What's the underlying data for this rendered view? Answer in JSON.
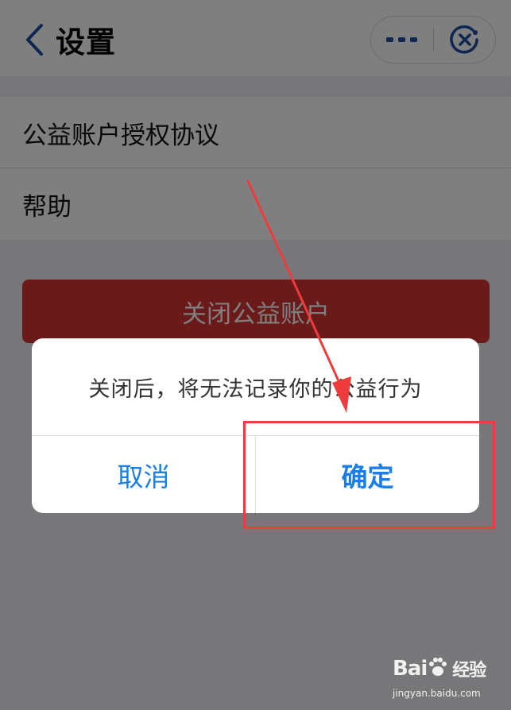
{
  "navbar": {
    "title": "设置",
    "back_icon": "chevron-left-icon",
    "more_icon": "more-dots-icon",
    "close_icon": "close-circle-icon",
    "accent_color": "#1a4fa0"
  },
  "settings_list": {
    "items": [
      {
        "label": "公益账户授权协议"
      },
      {
        "label": "帮助"
      }
    ]
  },
  "close_account_button": {
    "label": "关闭公益账户",
    "color": "#d63434"
  },
  "dialog": {
    "message": "关闭后，将无法记录你的公益行为",
    "cancel_label": "取消",
    "confirm_label": "确定",
    "button_color": "#1a7de8"
  },
  "annotation": {
    "color": "#ee3c3c"
  },
  "watermark": {
    "logo_left": "Bai",
    "logo_right": "经验",
    "url": "jingyan.baidu.com"
  }
}
